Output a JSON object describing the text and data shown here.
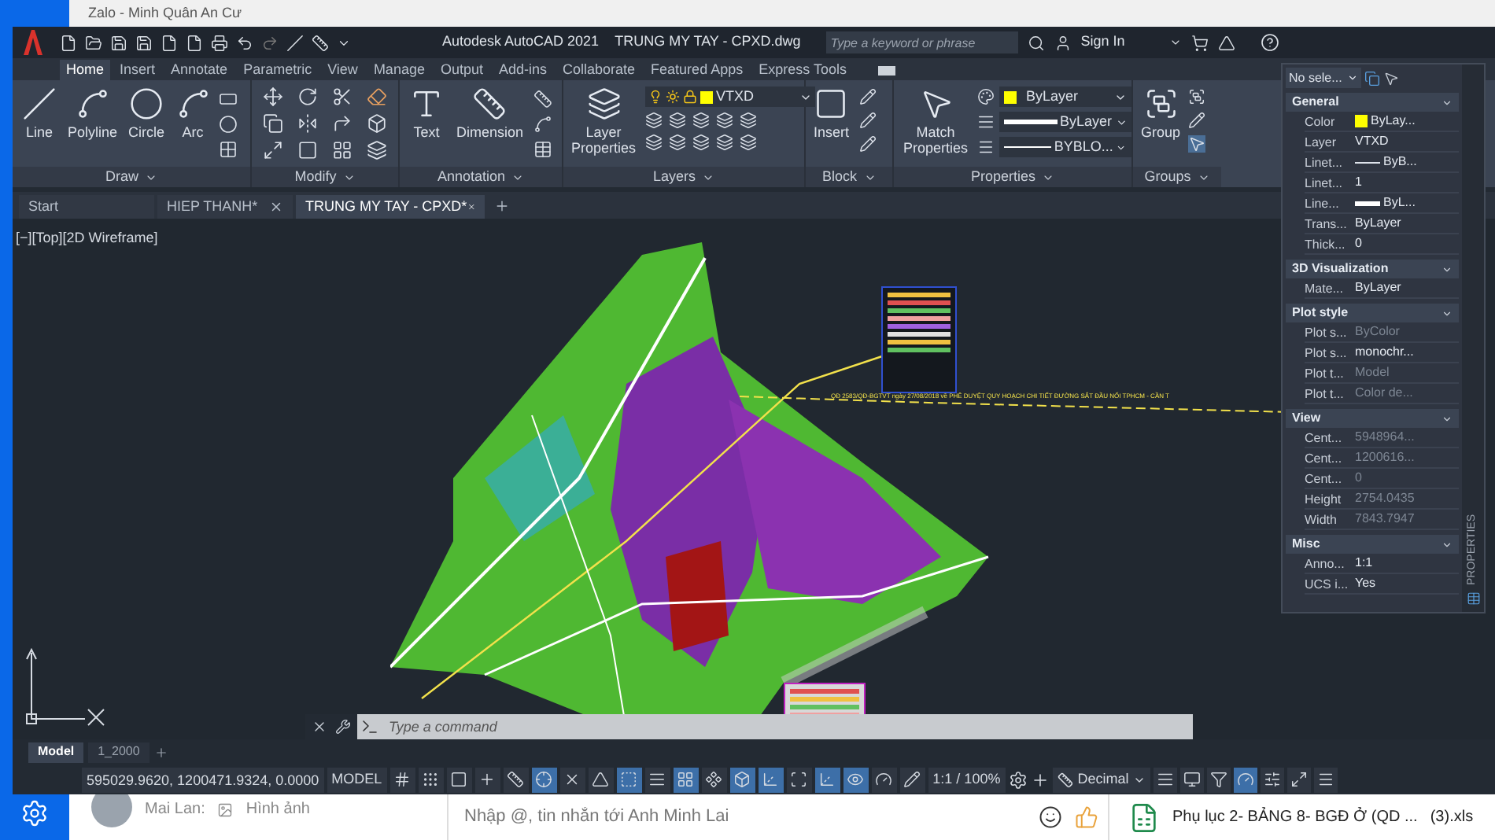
{
  "zalo": {
    "title": "Zalo - Minh Quân An Cư",
    "chat_preview": {
      "sender": "Mai Lan:",
      "message": "Hình ảnh"
    },
    "message_input": {
      "placeholder": "Nhập @, tin nhắn tới Anh Minh Lai"
    },
    "attachment": {
      "name": "Phụ lục 2- BẢNG 8- BGĐ Ở (QD ...",
      "suffix": "(3).xls"
    }
  },
  "autocad": {
    "title": "Autodesk AutoCAD 2021",
    "file_title": "TRUNG MY TAY - CPXD.dwg",
    "search": {
      "placeholder": "Type a keyword or phrase"
    },
    "sign_in": "Sign In",
    "ribbon_tabs": [
      {
        "label": "Home",
        "selected": true
      },
      {
        "label": "Insert",
        "selected": false
      },
      {
        "label": "Annotate",
        "selected": false
      },
      {
        "label": "Parametric",
        "selected": false
      },
      {
        "label": "View",
        "selected": false
      },
      {
        "label": "Manage",
        "selected": false
      },
      {
        "label": "Output",
        "selected": false
      },
      {
        "label": "Add-ins",
        "selected": false
      },
      {
        "label": "Collaborate",
        "selected": false
      },
      {
        "label": "Featured Apps",
        "selected": false
      },
      {
        "label": "Express Tools",
        "selected": false
      }
    ],
    "ribbon_panels": {
      "draw": {
        "title": "Draw",
        "tools": [
          "Line",
          "Polyline",
          "Circle",
          "Arc"
        ]
      },
      "modify": {
        "title": "Modify"
      },
      "annotation": {
        "title": "Annotation",
        "tools": [
          "Text",
          "Dimension"
        ]
      },
      "layers": {
        "title": "Layers",
        "tool": "Layer Properties",
        "layer": "VTXD"
      },
      "block": {
        "title": "Block",
        "tool": "Insert"
      },
      "properties": {
        "title": "Properties",
        "tool": "Match Properties",
        "color_value": "ByLayer",
        "lineweight": "ByLayer",
        "linetype": "BYBLO..."
      },
      "groups": {
        "title": "Groups",
        "tool": "Group"
      }
    },
    "file_tabs": [
      {
        "label": "Start",
        "selected": false,
        "closable": false
      },
      {
        "label": "HIEP THANH*",
        "selected": false,
        "closable": true
      },
      {
        "label": "TRUNG MY TAY - CPXD*",
        "selected": true,
        "closable": true
      }
    ],
    "viewport_label": "[−][Top][2D Wireframe]",
    "drawing_note": "QĐ 2583/QĐ-BGTVT ngày 27/08/2018 về PHÊ DUYỆT QUY HOẠCH CHI TIẾT ĐƯỜNG SẮT ĐẦU NỐI TPHCM - CẦN T",
    "properties_palette": {
      "selection": "No sele...",
      "side_label": "PROPERTIES",
      "sections": [
        {
          "title": "General",
          "rows": [
            {
              "label": "Color",
              "value": "ByLay...",
              "kind": "swatch",
              "color": "#ffff00",
              "disabled": false
            },
            {
              "label": "Layer",
              "value": "VTXD",
              "kind": "plain",
              "disabled": false
            },
            {
              "label": "Linet...",
              "value": "ByB...",
              "kind": "line",
              "disabled": false
            },
            {
              "label": "Linet...",
              "value": "1",
              "kind": "plain",
              "disabled": false
            },
            {
              "label": "Line...",
              "value": "ByL...",
              "kind": "thick",
              "disabled": false
            },
            {
              "label": "Trans...",
              "value": "ByLayer",
              "kind": "plain",
              "disabled": false
            },
            {
              "label": "Thick...",
              "value": "0",
              "kind": "plain",
              "disabled": false
            }
          ]
        },
        {
          "title": "3D Visualization",
          "rows": [
            {
              "label": "Mate...",
              "value": "ByLayer",
              "kind": "plain",
              "disabled": false
            }
          ]
        },
        {
          "title": "Plot style",
          "rows": [
            {
              "label": "Plot s...",
              "value": "ByColor",
              "kind": "plain",
              "disabled": true
            },
            {
              "label": "Plot s...",
              "value": "monochr...",
              "kind": "plain",
              "disabled": false
            },
            {
              "label": "Plot t...",
              "value": "Model",
              "kind": "plain",
              "disabled": true
            },
            {
              "label": "Plot t...",
              "value": "Color de...",
              "kind": "plain",
              "disabled": true
            }
          ]
        },
        {
          "title": "View",
          "rows": [
            {
              "label": "Cent...",
              "value": "5948964...",
              "kind": "plain",
              "disabled": true
            },
            {
              "label": "Cent...",
              "value": "1200616...",
              "kind": "plain",
              "disabled": true
            },
            {
              "label": "Cent...",
              "value": "0",
              "kind": "plain",
              "disabled": true
            },
            {
              "label": "Height",
              "value": "2754.0435",
              "kind": "plain",
              "disabled": true
            },
            {
              "label": "Width",
              "value": "7843.7947",
              "kind": "plain",
              "disabled": true
            }
          ]
        },
        {
          "title": "Misc",
          "rows": [
            {
              "label": "Anno...",
              "value": "1:1",
              "kind": "plain",
              "disabled": false
            },
            {
              "label": "UCS i...",
              "value": "Yes",
              "kind": "plain",
              "disabled": false
            }
          ]
        }
      ]
    },
    "command_line": {
      "placeholder": "Type a command"
    },
    "layout_tabs": [
      {
        "label": "Model",
        "selected": true
      },
      {
        "label": "1_2000",
        "selected": false
      }
    ],
    "status_bar": {
      "coordinates": "595029.9620, 1200471.9324, 0.0000",
      "mode": "MODEL",
      "toggles": [
        {
          "on": false
        },
        {
          "on": false
        },
        {
          "on": false
        },
        {
          "on": false
        },
        {
          "on": false
        },
        {
          "on": true
        },
        {
          "on": false
        },
        {
          "on": false
        },
        {
          "on": true
        },
        {
          "on": false
        },
        {
          "on": true
        },
        {
          "on": false
        },
        {
          "on": true
        },
        {
          "on": true
        },
        {
          "on": false
        },
        {
          "on": true
        },
        {
          "on": true
        },
        {
          "on": false
        },
        {
          "on": false
        }
      ],
      "scale": "1:1 / 100%",
      "units": "Decimal",
      "toggles_right": [
        {
          "on": false
        },
        {
          "on": false
        },
        {
          "on": false
        },
        {
          "on": true
        },
        {
          "on": false
        },
        {
          "on": false
        },
        {
          "on": false
        }
      ]
    }
  }
}
